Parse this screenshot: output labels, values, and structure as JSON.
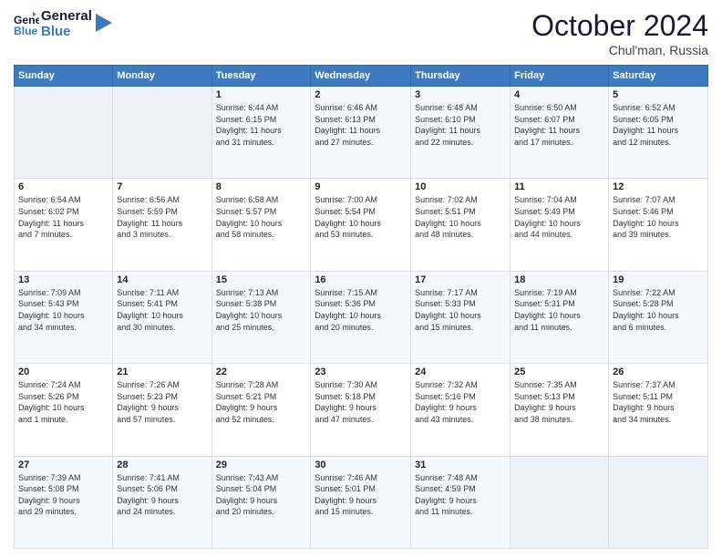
{
  "logo": {
    "line1": "General",
    "line2": "Blue"
  },
  "header": {
    "month": "October 2024",
    "location": "Chul'man, Russia"
  },
  "days_of_week": [
    "Sunday",
    "Monday",
    "Tuesday",
    "Wednesday",
    "Thursday",
    "Friday",
    "Saturday"
  ],
  "weeks": [
    [
      {
        "day": "",
        "detail": ""
      },
      {
        "day": "",
        "detail": ""
      },
      {
        "day": "1",
        "detail": "Sunrise: 6:44 AM\nSunset: 6:15 PM\nDaylight: 11 hours\nand 31 minutes."
      },
      {
        "day": "2",
        "detail": "Sunrise: 6:46 AM\nSunset: 6:13 PM\nDaylight: 11 hours\nand 27 minutes."
      },
      {
        "day": "3",
        "detail": "Sunrise: 6:48 AM\nSunset: 6:10 PM\nDaylight: 11 hours\nand 22 minutes."
      },
      {
        "day": "4",
        "detail": "Sunrise: 6:50 AM\nSunset: 6:07 PM\nDaylight: 11 hours\nand 17 minutes."
      },
      {
        "day": "5",
        "detail": "Sunrise: 6:52 AM\nSunset: 6:05 PM\nDaylight: 11 hours\nand 12 minutes."
      }
    ],
    [
      {
        "day": "6",
        "detail": "Sunrise: 6:54 AM\nSunset: 6:02 PM\nDaylight: 11 hours\nand 7 minutes."
      },
      {
        "day": "7",
        "detail": "Sunrise: 6:56 AM\nSunset: 5:59 PM\nDaylight: 11 hours\nand 3 minutes."
      },
      {
        "day": "8",
        "detail": "Sunrise: 6:58 AM\nSunset: 5:57 PM\nDaylight: 10 hours\nand 58 minutes."
      },
      {
        "day": "9",
        "detail": "Sunrise: 7:00 AM\nSunset: 5:54 PM\nDaylight: 10 hours\nand 53 minutes."
      },
      {
        "day": "10",
        "detail": "Sunrise: 7:02 AM\nSunset: 5:51 PM\nDaylight: 10 hours\nand 48 minutes."
      },
      {
        "day": "11",
        "detail": "Sunrise: 7:04 AM\nSunset: 5:49 PM\nDaylight: 10 hours\nand 44 minutes."
      },
      {
        "day": "12",
        "detail": "Sunrise: 7:07 AM\nSunset: 5:46 PM\nDaylight: 10 hours\nand 39 minutes."
      }
    ],
    [
      {
        "day": "13",
        "detail": "Sunrise: 7:09 AM\nSunset: 5:43 PM\nDaylight: 10 hours\nand 34 minutes."
      },
      {
        "day": "14",
        "detail": "Sunrise: 7:11 AM\nSunset: 5:41 PM\nDaylight: 10 hours\nand 30 minutes."
      },
      {
        "day": "15",
        "detail": "Sunrise: 7:13 AM\nSunset: 5:38 PM\nDaylight: 10 hours\nand 25 minutes."
      },
      {
        "day": "16",
        "detail": "Sunrise: 7:15 AM\nSunset: 5:36 PM\nDaylight: 10 hours\nand 20 minutes."
      },
      {
        "day": "17",
        "detail": "Sunrise: 7:17 AM\nSunset: 5:33 PM\nDaylight: 10 hours\nand 15 minutes."
      },
      {
        "day": "18",
        "detail": "Sunrise: 7:19 AM\nSunset: 5:31 PM\nDaylight: 10 hours\nand 11 minutes."
      },
      {
        "day": "19",
        "detail": "Sunrise: 7:22 AM\nSunset: 5:28 PM\nDaylight: 10 hours\nand 6 minutes."
      }
    ],
    [
      {
        "day": "20",
        "detail": "Sunrise: 7:24 AM\nSunset: 5:26 PM\nDaylight: 10 hours\nand 1 minute."
      },
      {
        "day": "21",
        "detail": "Sunrise: 7:26 AM\nSunset: 5:23 PM\nDaylight: 9 hours\nand 57 minutes."
      },
      {
        "day": "22",
        "detail": "Sunrise: 7:28 AM\nSunset: 5:21 PM\nDaylight: 9 hours\nand 52 minutes."
      },
      {
        "day": "23",
        "detail": "Sunrise: 7:30 AM\nSunset: 5:18 PM\nDaylight: 9 hours\nand 47 minutes."
      },
      {
        "day": "24",
        "detail": "Sunrise: 7:32 AM\nSunset: 5:16 PM\nDaylight: 9 hours\nand 43 minutes."
      },
      {
        "day": "25",
        "detail": "Sunrise: 7:35 AM\nSunset: 5:13 PM\nDaylight: 9 hours\nand 38 minutes."
      },
      {
        "day": "26",
        "detail": "Sunrise: 7:37 AM\nSunset: 5:11 PM\nDaylight: 9 hours\nand 34 minutes."
      }
    ],
    [
      {
        "day": "27",
        "detail": "Sunrise: 7:39 AM\nSunset: 5:08 PM\nDaylight: 9 hours\nand 29 minutes."
      },
      {
        "day": "28",
        "detail": "Sunrise: 7:41 AM\nSunset: 5:06 PM\nDaylight: 9 hours\nand 24 minutes."
      },
      {
        "day": "29",
        "detail": "Sunrise: 7:43 AM\nSunset: 5:04 PM\nDaylight: 9 hours\nand 20 minutes."
      },
      {
        "day": "30",
        "detail": "Sunrise: 7:46 AM\nSunset: 5:01 PM\nDaylight: 9 hours\nand 15 minutes."
      },
      {
        "day": "31",
        "detail": "Sunrise: 7:48 AM\nSunset: 4:59 PM\nDaylight: 9 hours\nand 11 minutes."
      },
      {
        "day": "",
        "detail": ""
      },
      {
        "day": "",
        "detail": ""
      }
    ]
  ]
}
